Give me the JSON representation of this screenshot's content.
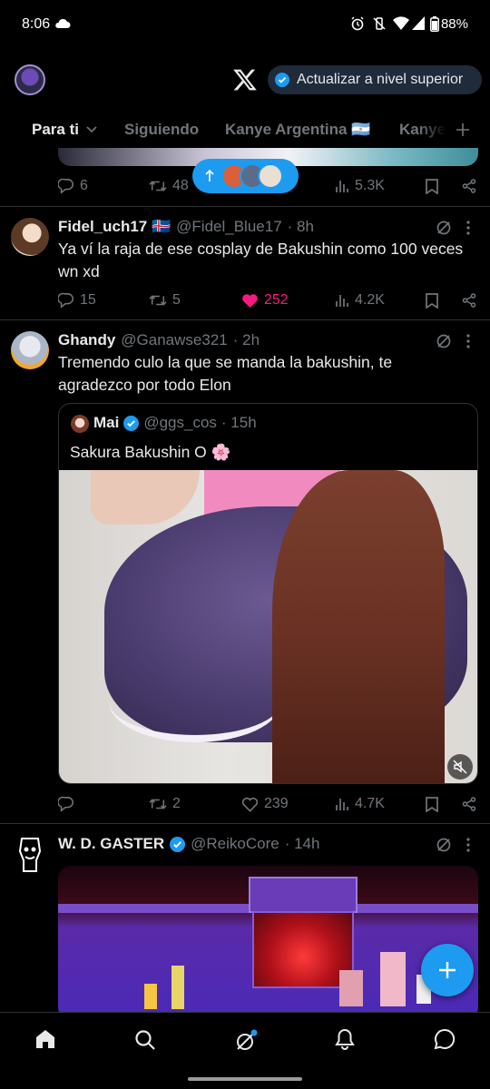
{
  "status_bar": {
    "time": "8:06",
    "battery": "88%"
  },
  "header": {
    "upgrade_label": "Actualizar a nivel superior"
  },
  "tabs": [
    {
      "label": "Para ti"
    },
    {
      "label": "Siguiendo"
    },
    {
      "label": "Kanye Argentina 🇦🇷"
    },
    {
      "label": "Kanye"
    }
  ],
  "tweet0": {
    "replies": "6",
    "retweets": "48",
    "views": "5.3K"
  },
  "tweet1": {
    "name": "Fidel_uch17 🇮🇸",
    "handle": "@Fidel_Blue17",
    "time": "· 8h",
    "text": "Ya ví la raja de ese cosplay de Bakushin como 100 veces wn xd",
    "replies": "15",
    "retweets": "5",
    "likes": "252",
    "views": "4.2K"
  },
  "tweet2": {
    "name": "Ghandy",
    "handle": "@Ganawse321",
    "time": "· 2h",
    "text": "Tremendo culo la que se manda la bakushin, te agradezco por todo Elon",
    "quote": {
      "name": "Mai",
      "handle": "@ggs_cos",
      "time": "· 15h",
      "text": "Sakura Bakushin O 🌸"
    },
    "replies": "",
    "retweets": "2",
    "likes": "239",
    "views": "4.7K"
  },
  "tweet3": {
    "name": "W. D. GASTER",
    "handle": "@ReikoCore",
    "time": "· 14h"
  },
  "colors": {
    "accent": "#1d9bf0",
    "like": "#f91880",
    "muted": "#71767b",
    "separator": "#2f3336"
  }
}
